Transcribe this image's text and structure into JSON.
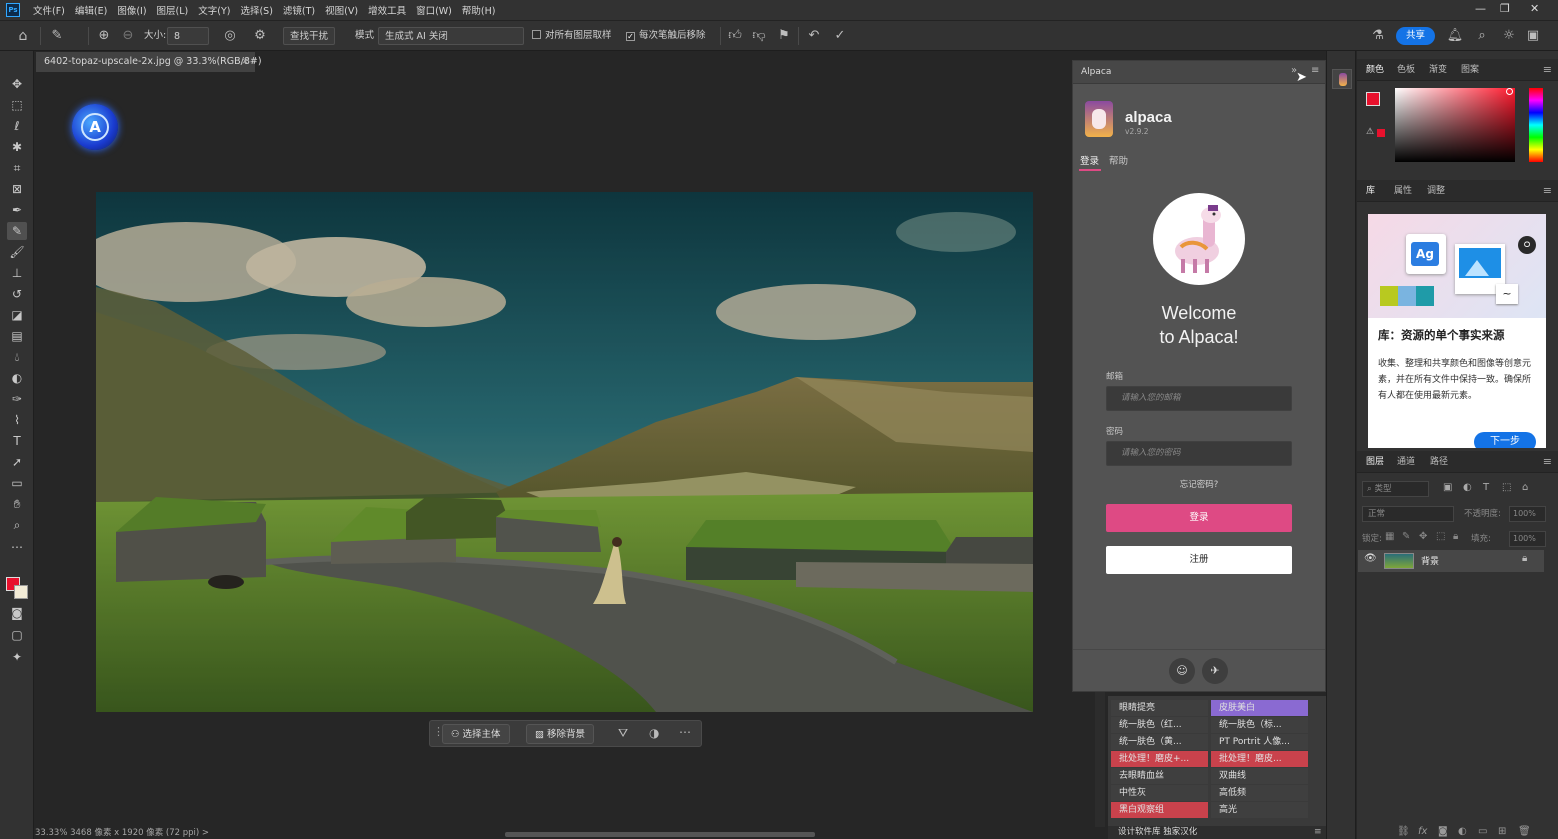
{
  "app": {
    "menu": [
      "文件(F)",
      "编辑(E)",
      "图像(I)",
      "图层(L)",
      "文字(Y)",
      "选择(S)",
      "滤镜(T)",
      "视图(V)",
      "增效工具",
      "窗口(W)",
      "帮助(H)"
    ],
    "logo": "Ps"
  },
  "options": {
    "size_label": "大小:",
    "size_value": "8",
    "content_aware": "查找干扰",
    "mode_label": "模式",
    "mode_value": "生成式 AI 关闭",
    "sample_all": "对所有图层取样",
    "remove_after": "每次笔触后移除",
    "share": "共享",
    "sample_all_checked": false,
    "remove_after_checked": true
  },
  "document": {
    "tab_title": "6402-topaz-upscale-2x.jpg @ 33.3%(RGB/8#)",
    "status": "33.33%   3468 像素 x 1920 像素 (72 ppi)   >"
  },
  "contextbar": {
    "select_subject": "选择主体",
    "remove_bg": "移除背景"
  },
  "alpaca": {
    "tab": "Alpaca",
    "name": "alpaca",
    "version": "v2.9.2",
    "nav_login": "登录",
    "nav_help": "帮助",
    "welcome_line1": "Welcome",
    "welcome_line2": "to Alpaca!",
    "email_label": "邮箱",
    "email_placeholder": "请输入您的邮箱",
    "password_label": "密码",
    "password_placeholder": "请输入您的密码",
    "forgot": "忘记密码?",
    "login_button": "登录",
    "register_button": "注册",
    "accent_color": "#de4a84"
  },
  "actions": {
    "left": [
      "眼睛提亮",
      "统一肤色（红...",
      "统一肤色（黄...",
      "批处理！磨皮+...",
      "去眼睛血丝",
      "中性灰",
      "黑白观察组"
    ],
    "right": [
      "皮肤美白",
      "统一肤色（标...",
      "PT Portrit 人像...",
      "批处理！磨皮...",
      "双曲线",
      "高低频",
      "高光"
    ],
    "footer": "设计软件库 独家汉化"
  },
  "right_dock": {
    "color_tabs": [
      "颜色",
      "色板",
      "渐变",
      "图案"
    ],
    "lib_tabs": [
      "库",
      "属性",
      "调整"
    ],
    "lib_title": "库：资源的单个事实来源",
    "lib_desc": "收集、整理和共享颜色和图像等创意元素，并在所有文件中保持一致。确保所有人都在使用最新元素。",
    "lib_next": "下一步",
    "lib_ag": "Ag",
    "layers_tabs": [
      "图层",
      "通道",
      "路径"
    ],
    "layers_search": "类型",
    "blend_mode": "正常",
    "opacity_label": "不透明度:",
    "opacity_value": "100%",
    "lock_label": "锁定:",
    "fill_label": "填充:",
    "fill_value": "100%",
    "layer_name": "背景"
  }
}
